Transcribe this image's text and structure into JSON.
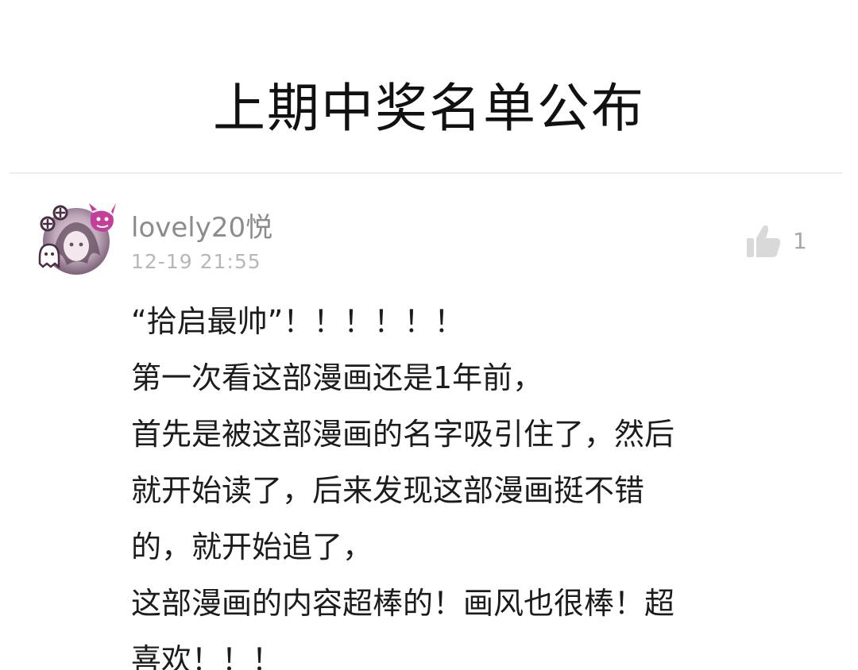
{
  "header": {
    "title": "上期中奖名单公布"
  },
  "comment": {
    "username": "lovely20悦",
    "timestamp": "12-19 21:55",
    "like_count": "1",
    "lines": [
      "“拾启最帅”！！！！！！",
      "第一次看这部漫画还是1年前，",
      "首先是被这部漫画的名字吸引住了，然后",
      "就开始读了，后来发现这部漫画挺不错",
      "的，就开始追了，",
      "这部漫画的内容超棒的！画风也很棒！超",
      "喜欢！！！"
    ]
  },
  "icons": {
    "avatar": "avatar-anime-girl",
    "like": "thumbs-up-icon"
  },
  "colors": {
    "title": "#111111",
    "username": "#8c8c8c",
    "timestamp": "#b7b7b7",
    "like": "#d9d9d9",
    "divider": "#ececec",
    "avatar_accent": "#c2409a"
  }
}
